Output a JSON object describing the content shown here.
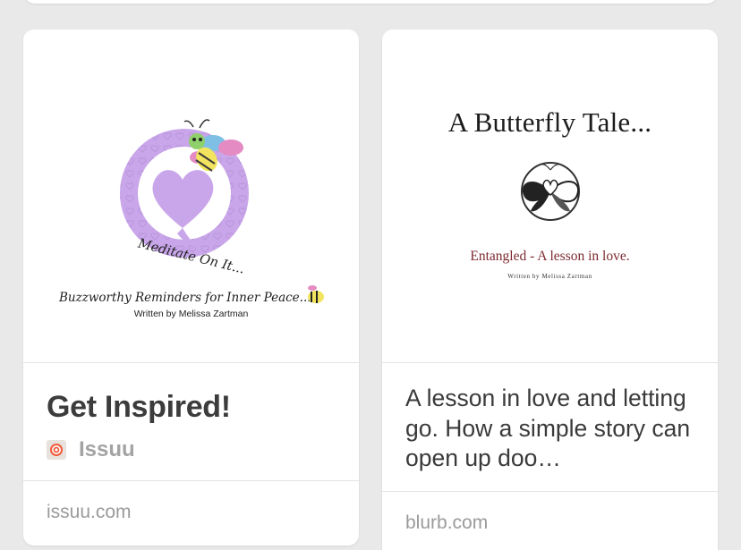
{
  "cards": [
    {
      "thumbnail": {
        "caption": "Meditate On It...",
        "tagline": "Buzzworthy Reminders for Inner Peace...",
        "written_by": "Written by Melissa Zartman"
      },
      "title": "Get Inspired!",
      "source": {
        "name": "Issuu",
        "icon": "issuu-logo-icon"
      },
      "domain": "issuu.com"
    },
    {
      "thumbnail": {
        "book_title": "A Butterfly Tale...",
        "subtitle": "Entangled - A lesson in love.",
        "written_by": "Written by Melissa Zartman"
      },
      "description": "A lesson in love and letting go. How a simple story can open up doo…",
      "domain": "blurb.com"
    }
  ]
}
